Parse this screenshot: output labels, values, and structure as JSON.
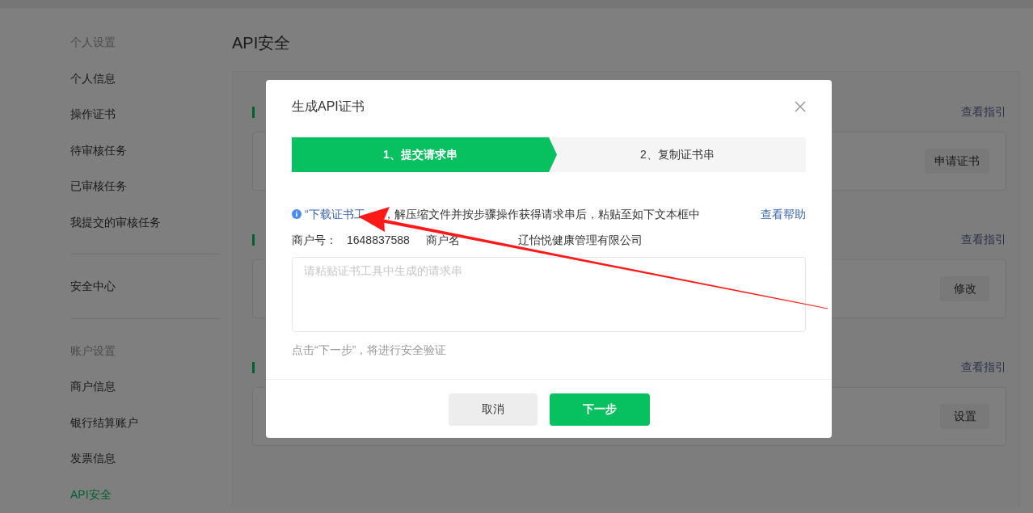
{
  "sidebar": {
    "sections": [
      {
        "title": "个人设置",
        "items": [
          {
            "label": "个人信息",
            "selected": false
          },
          {
            "label": "操作证书",
            "selected": false
          },
          {
            "label": "待审核任务",
            "selected": false
          },
          {
            "label": "已审核任务",
            "selected": false
          },
          {
            "label": "我提交的审核任务",
            "selected": false
          }
        ]
      },
      {
        "items": [
          {
            "label": "安全中心",
            "selected": false
          }
        ]
      },
      {
        "title": "账户设置",
        "items": [
          {
            "label": "商户信息",
            "selected": false
          },
          {
            "label": "银行结算账户",
            "selected": false
          },
          {
            "label": "发票信息",
            "selected": false
          },
          {
            "label": "API安全",
            "selected": true
          }
        ]
      }
    ]
  },
  "page_title": "API安全",
  "sections": [
    {
      "guide_link": "查看指引",
      "button": "申请证书"
    },
    {
      "guide_link": "查看指引",
      "button": "修改"
    },
    {
      "guide_link": "查看指引",
      "button": "设置"
    }
  ],
  "dialog": {
    "title": "生成API证书",
    "steps": [
      {
        "label": "1、提交请求串",
        "selected": true
      },
      {
        "label": "2、复制证书串",
        "selected": false
      }
    ],
    "info": {
      "link": "“下载证书工",
      "text": "，解压缩文件并按步骤操作获得请求串后，粘贴至如下文本框中",
      "help_link": "查看帮助"
    },
    "merchant": {
      "id_label": "商户号：",
      "id": "1648837588",
      "name_label": "商户名",
      "name": "辽怡悦健康管理有限公司"
    },
    "request_field": {
      "placeholder": "请粘贴证书工具中生成的请求串"
    },
    "hint": "点击“下一步”，将进行安全验证",
    "buttons": [
      {
        "label": "取消",
        "kind": "secondary"
      },
      {
        "label": "下一步",
        "kind": "primary"
      }
    ]
  },
  "annotation": {
    "kind": "arrow"
  }
}
